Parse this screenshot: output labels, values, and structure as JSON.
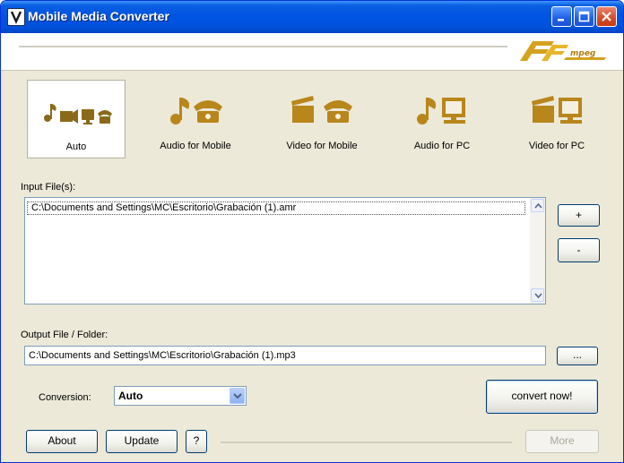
{
  "window": {
    "title": "Mobile Media Converter"
  },
  "logo": {
    "text": "FFmpeg"
  },
  "modes": [
    {
      "label": "Auto",
      "selected": true,
      "icon": "auto-icon"
    },
    {
      "label": "Audio for Mobile",
      "selected": false,
      "icon": "audio-mobile-icon"
    },
    {
      "label": "Video for Mobile",
      "selected": false,
      "icon": "video-mobile-icon"
    },
    {
      "label": "Audio for PC",
      "selected": false,
      "icon": "audio-pc-icon"
    },
    {
      "label": "Video for PC",
      "selected": false,
      "icon": "video-pc-icon"
    }
  ],
  "input": {
    "label": "Input File(s):",
    "files": [
      "C:\\Documents and Settings\\MC\\Escritorio\\Grabación (1).amr"
    ],
    "add_label": "+",
    "remove_label": "-"
  },
  "output": {
    "label": "Output File / Folder:",
    "value": "C:\\Documents and Settings\\MC\\Escritorio\\Grabación (1).mp3",
    "browse_label": "..."
  },
  "conversion": {
    "label": "Conversion:",
    "value": "Auto"
  },
  "convert_label": "convert now!",
  "footer": {
    "about_label": "About",
    "update_label": "Update",
    "help_label": "?",
    "more_label": "More"
  },
  "colors": {
    "accent": "#b8861b",
    "titlebar": "#0054e3",
    "window_bg": "#ece9d8"
  }
}
